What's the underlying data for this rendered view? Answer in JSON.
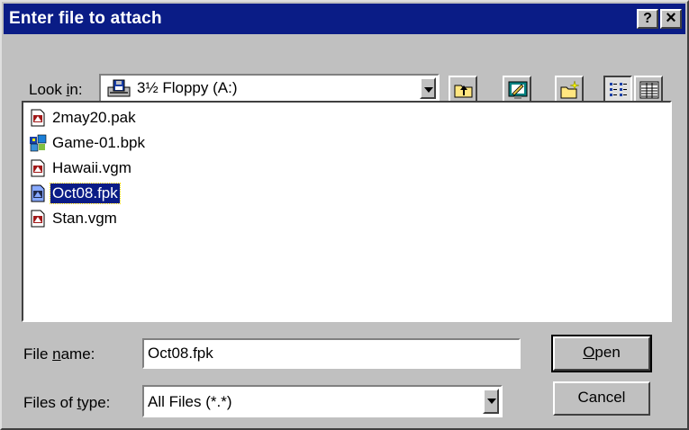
{
  "dialog": {
    "title": "Enter file to attach",
    "help_button": "?",
    "close_button": "×"
  },
  "look_in": {
    "label_prefix": "Look ",
    "label_accel": "i",
    "label_suffix": "n:",
    "value": "3½ Floppy (A:)",
    "drive_icon": "floppy-drive-icon"
  },
  "toolbar": {
    "buttons": [
      {
        "name": "up-one-level",
        "icon": "folder-up-icon"
      },
      {
        "name": "desktop",
        "icon": "desktop-icon"
      },
      {
        "name": "new-folder",
        "icon": "new-folder-icon"
      },
      {
        "name": "list-view",
        "icon": "list-view-icon",
        "pressed": true
      },
      {
        "name": "details-view",
        "icon": "details-view-icon"
      }
    ]
  },
  "files": [
    {
      "name": "2may20.pak",
      "icon": "file-pak-icon",
      "selected": false
    },
    {
      "name": "Game-01.bpk",
      "icon": "file-game-icon",
      "selected": false
    },
    {
      "name": "Hawaii.vgm",
      "icon": "file-vgm-icon",
      "selected": false
    },
    {
      "name": "Oct08.fpk",
      "icon": "file-fpk-icon",
      "selected": true
    },
    {
      "name": "Stan.vgm",
      "icon": "file-vgm-icon",
      "selected": false
    }
  ],
  "file_name": {
    "label_prefix": "File ",
    "label_accel": "n",
    "label_suffix": "ame:",
    "value": "Oct08.fpk"
  },
  "file_type": {
    "label_prefix": "Files of ",
    "label_accel": "t",
    "label_suffix": "ype:",
    "value": "All Files (*.*)"
  },
  "buttons": {
    "open_accel": "O",
    "open_rest": "pen",
    "cancel": "Cancel"
  },
  "colors": {
    "titlebar": "#0a1c86",
    "face": "#c0c0c0",
    "selection": "#0a1c86"
  }
}
